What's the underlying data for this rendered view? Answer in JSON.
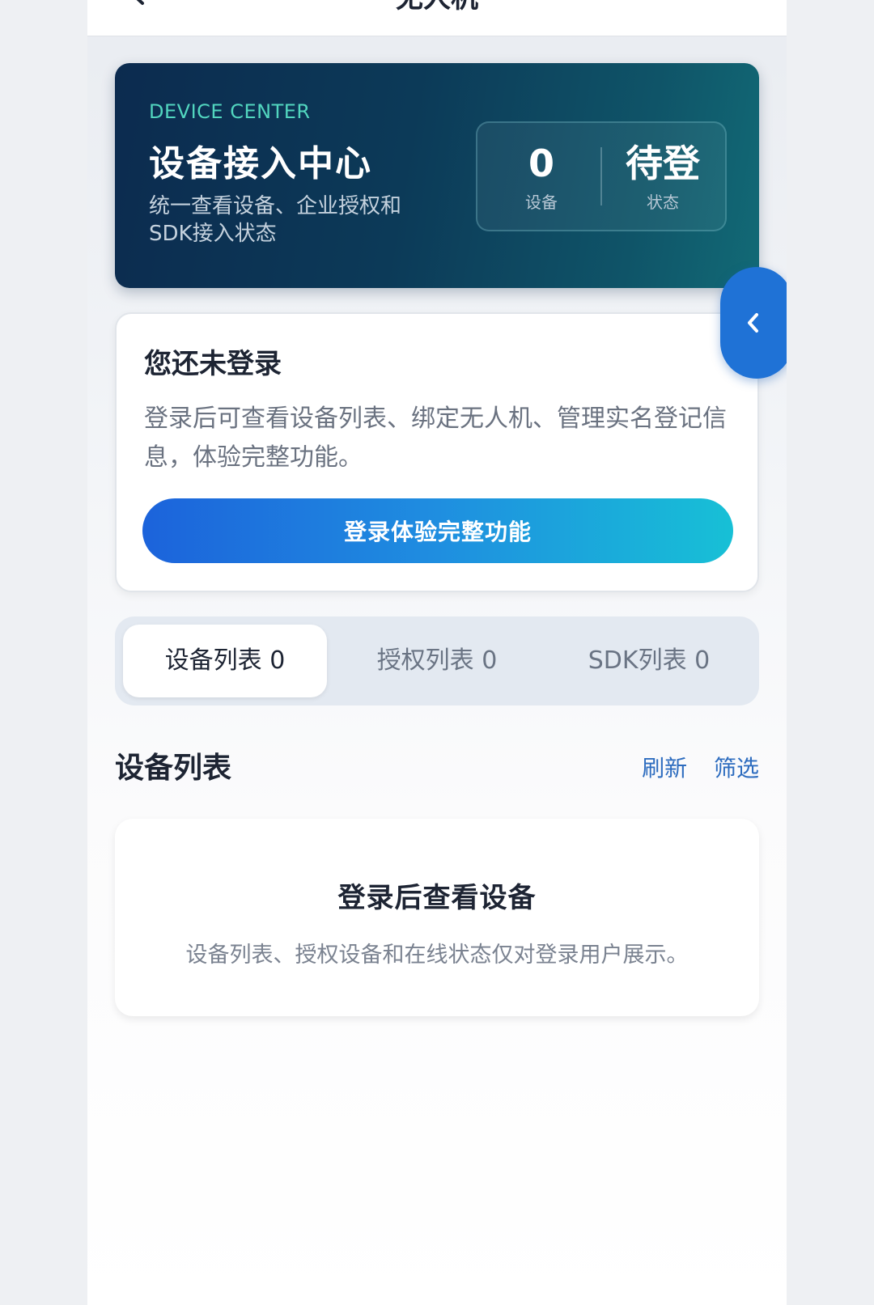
{
  "nav": {
    "title": "无人机"
  },
  "hero": {
    "tag": "DEVICE CENTER",
    "title": "设备接入中心",
    "subtitle": "统一查看设备、企业授权和SDK接入状态",
    "stats": [
      {
        "value": "0",
        "label": "设备"
      },
      {
        "value": "待登",
        "label": "状态"
      }
    ]
  },
  "login_card": {
    "title": "您还未登录",
    "description": "登录后可查看设备列表、绑定无人机、管理实名登记信息，体验完整功能。",
    "button_label": "登录体验完整功能"
  },
  "tabs": [
    {
      "label": "设备列表  0",
      "active": true
    },
    {
      "label": "授权列表  0",
      "active": false
    },
    {
      "label": "SDK列表  0",
      "active": false
    }
  ],
  "section": {
    "title": "设备列表",
    "refresh_label": "刷新",
    "filter_label": "筛选"
  },
  "empty_state": {
    "title": "登录后查看设备",
    "description": "设备列表、授权设备和在线状态仅对登录用户展示。"
  },
  "colors": {
    "accent": "#1f72d6",
    "link": "#2d6cbf",
    "hero_tag": "#52d6bf"
  },
  "icons": {
    "nav_back": "chevron-left-icon",
    "side_tab": "chevron-left-icon"
  }
}
